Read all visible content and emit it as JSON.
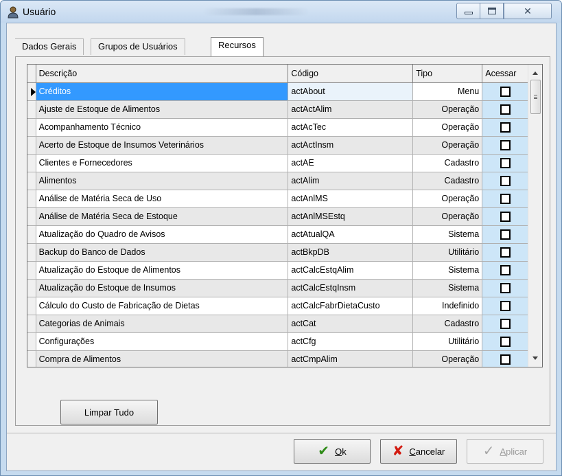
{
  "window": {
    "title": "Usuário",
    "controls": {
      "minimize": "minimize-icon",
      "maximize": "maximize-icon",
      "close": "close-icon"
    }
  },
  "tabs": [
    {
      "label": "Dados Gerais",
      "active": false
    },
    {
      "label": "Grupos de Usuários",
      "active": false
    },
    {
      "label": "Recursos",
      "active": true
    }
  ],
  "grid": {
    "columns": {
      "descricao": "Descrição",
      "codigo": "Código",
      "tipo": "Tipo",
      "acessar": "Acessar"
    },
    "rows": [
      {
        "descricao": "Créditos",
        "codigo": "actAbout",
        "tipo": "Menu",
        "acessar": false
      },
      {
        "descricao": "Ajuste de Estoque de Alimentos",
        "codigo": "actActAlim",
        "tipo": "Operação",
        "acessar": false
      },
      {
        "descricao": "Acompanhamento Técnico",
        "codigo": "actAcTec",
        "tipo": "Operação",
        "acessar": false
      },
      {
        "descricao": "Acerto de Estoque de Insumos Veterinários",
        "codigo": "actActInsm",
        "tipo": "Operação",
        "acessar": false
      },
      {
        "descricao": "Clientes e Fornecedores",
        "codigo": "actAE",
        "tipo": "Cadastro",
        "acessar": false
      },
      {
        "descricao": "Alimentos",
        "codigo": "actAlim",
        "tipo": "Cadastro",
        "acessar": false
      },
      {
        "descricao": "Análise de Matéria Seca de Uso",
        "codigo": "actAnlMS",
        "tipo": "Operação",
        "acessar": false
      },
      {
        "descricao": "Análise de Matéria Seca de Estoque",
        "codigo": "actAnlMSEstq",
        "tipo": "Operação",
        "acessar": false
      },
      {
        "descricao": "Atualização do Quadro de Avisos",
        "codigo": "actAtualQA",
        "tipo": "Sistema",
        "acessar": false
      },
      {
        "descricao": "Backup do Banco de Dados",
        "codigo": "actBkpDB",
        "tipo": "Utilitário",
        "acessar": false
      },
      {
        "descricao": "Atualização do Estoque de Alimentos",
        "codigo": "actCalcEstqAlim",
        "tipo": "Sistema",
        "acessar": false
      },
      {
        "descricao": "Atualização do Estoque de Insumos",
        "codigo": "actCalcEstqInsm",
        "tipo": "Sistema",
        "acessar": false
      },
      {
        "descricao": "Cálculo do Custo de Fabricação de Dietas",
        "codigo": "actCalcFabrDietaCusto",
        "tipo": "Indefinido",
        "acessar": false
      },
      {
        "descricao": "Categorias de Animais",
        "codigo": "actCat",
        "tipo": "Cadastro",
        "acessar": false
      },
      {
        "descricao": "Configurações",
        "codigo": "actCfg",
        "tipo": "Utilitário",
        "acessar": false
      },
      {
        "descricao": "Compra de Alimentos",
        "codigo": "actCmpAlim",
        "tipo": "Operação",
        "acessar": false
      }
    ],
    "selected_row": 0
  },
  "buttons": {
    "limpar_tudo": "Limpar Tudo",
    "ok": {
      "accel": "O",
      "rest": "k"
    },
    "cancelar": {
      "accel": "C",
      "rest": "ancelar"
    },
    "aplicar": {
      "accel": "A",
      "rest": "plicar"
    }
  },
  "colors": {
    "selection": "#3399ff",
    "accessar_column": "#cde6f8",
    "title_bar": "#c6dbef",
    "ok_icon": "#2f8b18",
    "cancel_icon": "#d21a10"
  }
}
